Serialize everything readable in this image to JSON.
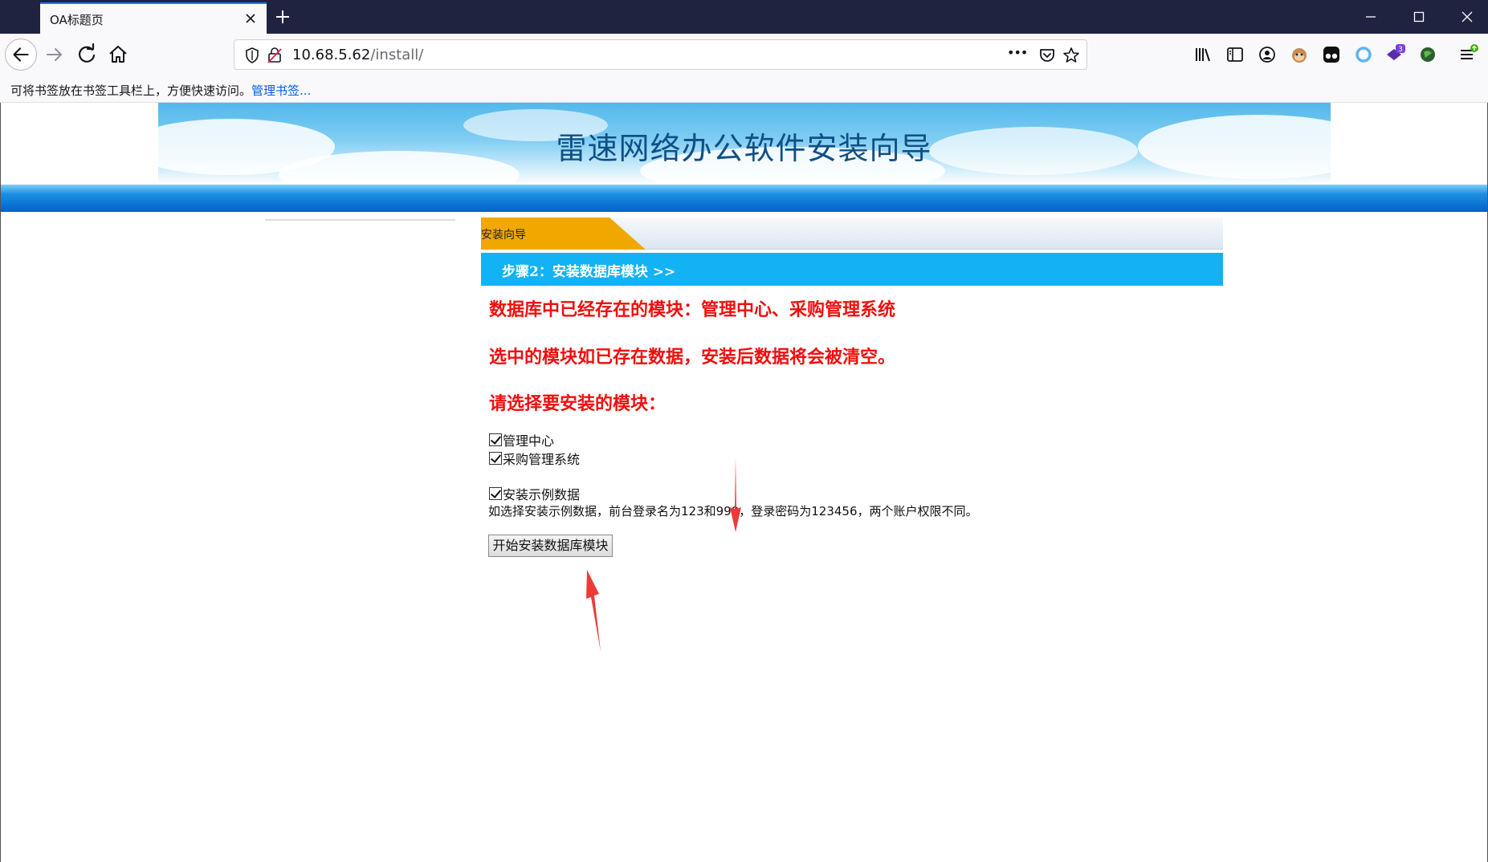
{
  "browser": {
    "tab_title": "OA标题页",
    "url_host": "10.68.5.62",
    "url_path": "/install/",
    "more_label": "•••",
    "badge_count": "3"
  },
  "bookmarks_bar": {
    "text": "可将书签放在书签工具栏上，方便快速访问。",
    "link": "管理书签..."
  },
  "banner": {
    "title": "雷速网络办公软件安装向导"
  },
  "wizard": {
    "tab_label": "安装向导",
    "step_title": "步骤2：安装数据库模块 >>"
  },
  "messages": {
    "existing": "数据库中已经存在的模块：管理中心、采购管理系统",
    "warning": "选中的模块如已存在数据，安装后数据将会被清空。",
    "select_prompt": "请选择要安装的模块："
  },
  "modules": [
    {
      "label": "管理中心",
      "checked": true
    },
    {
      "label": "采购管理系统",
      "checked": true
    }
  ],
  "sample_data": {
    "label": "安装示例数据",
    "checked": true,
    "hint": "如选择安装示例数据，前台登录名为123和999，登录密码为123456，两个账户权限不同。"
  },
  "actions": {
    "start_button": "开始安装数据库模块"
  },
  "colors": {
    "warning_red": "#f20d0d",
    "step_bar_blue": "#12b2f5",
    "wizard_tab_orange": "#f0a800",
    "annotation_arrow": "#f03a3a"
  }
}
